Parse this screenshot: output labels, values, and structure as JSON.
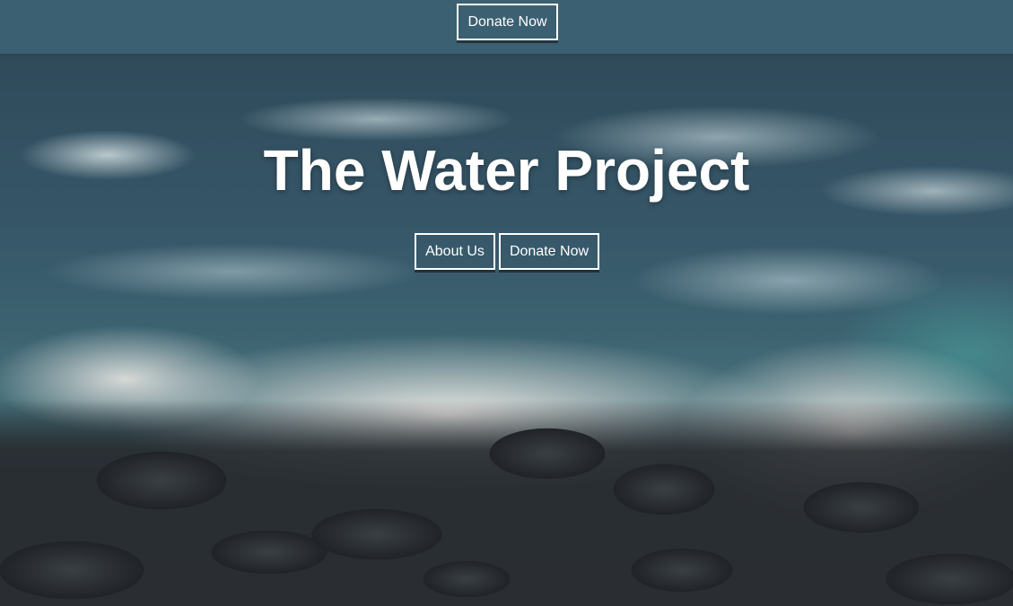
{
  "topbar": {
    "donate_label": "Donate Now"
  },
  "hero": {
    "title": "The Water Project",
    "buttons": {
      "about_label": "About Us",
      "donate_label": "Donate Now"
    }
  },
  "colors": {
    "topbar_background": "#3b6071",
    "button_text": "#ffffff",
    "button_border": "#ffffff"
  }
}
